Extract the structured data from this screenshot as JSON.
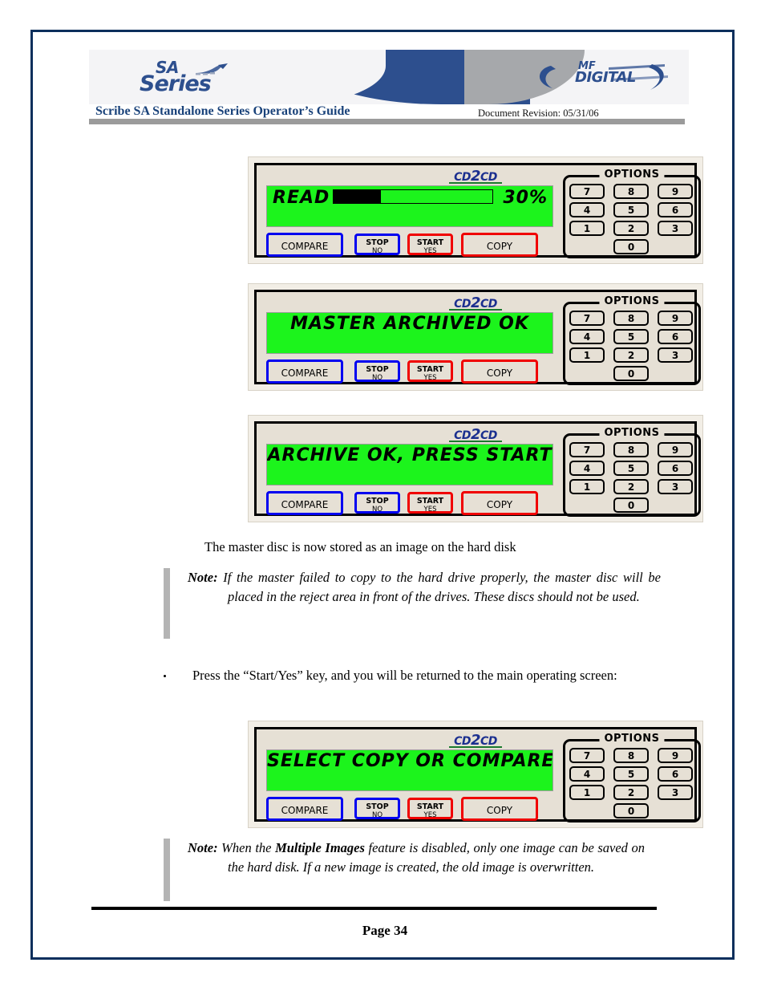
{
  "header": {
    "sa_logo": {
      "line1": "SA",
      "line2": "Series",
      "mark": "swoosh-bird-mark"
    },
    "mf_logo": {
      "line1": "MF",
      "line2": "DIGITAL"
    },
    "doc_title": "Scribe SA Standalone Series Operator’s Guide",
    "doc_revision": "Document Revision: 05/31/06"
  },
  "panels": [
    {
      "id": "panel-read-progress",
      "brand": "CD2CD",
      "lcd_mode": "progress",
      "lcd_label": "READ",
      "lcd_percent_text": "30%",
      "lcd_percent_value": 30,
      "buttons": {
        "compare": "COMPARE",
        "stop_l1": "STOP",
        "stop_l2": "NO",
        "start_l1": "START",
        "start_l2": "YES",
        "copy": "COPY"
      },
      "options_label": "OPTIONS",
      "keys": [
        "7",
        "8",
        "9",
        "4",
        "5",
        "6",
        "1",
        "2",
        "3",
        "0"
      ]
    },
    {
      "id": "panel-master-archived",
      "brand": "CD2CD",
      "lcd_mode": "text",
      "lcd_text": "MASTER ARCHIVED OK",
      "buttons": {
        "compare": "COMPARE",
        "stop_l1": "STOP",
        "stop_l2": "NO",
        "start_l1": "START",
        "start_l2": "YES",
        "copy": "COPY"
      },
      "options_label": "OPTIONS",
      "keys": [
        "7",
        "8",
        "9",
        "4",
        "5",
        "6",
        "1",
        "2",
        "3",
        "0"
      ]
    },
    {
      "id": "panel-archive-ok",
      "brand": "CD2CD",
      "lcd_mode": "text",
      "lcd_text": "ARCHIVE OK, PRESS START",
      "buttons": {
        "compare": "COMPARE",
        "stop_l1": "STOP",
        "stop_l2": "NO",
        "start_l1": "START",
        "start_l2": "YES",
        "copy": "COPY"
      },
      "options_label": "OPTIONS",
      "keys": [
        "7",
        "8",
        "9",
        "4",
        "5",
        "6",
        "1",
        "2",
        "3",
        "0"
      ]
    },
    {
      "id": "panel-select-copy-compare",
      "brand": "CD2CD",
      "lcd_mode": "text",
      "lcd_text": "SELECT COPY OR COMPARE",
      "buttons": {
        "compare": "COMPARE",
        "stop_l1": "STOP",
        "stop_l2": "NO",
        "start_l1": "START",
        "start_l2": "YES",
        "copy": "COPY"
      },
      "options_label": "OPTIONS",
      "keys": [
        "7",
        "8",
        "9",
        "4",
        "5",
        "6",
        "1",
        "2",
        "3",
        "0"
      ]
    }
  ],
  "body": {
    "caption_after_panels": "The master disc is now stored as an image on the hard disk",
    "note1_label": "Note:",
    "note1_text": "If the master failed to copy to the hard drive properly, the master disc will be placed in the reject area in front of the drives. These discs should not be used.",
    "bullet1_text": "Press the “Start/Yes” key, and you will be returned to the main operating screen:",
    "note2_label": "Note:",
    "note2_part1": "When the ",
    "note2_emphasis": "Multiple Images",
    "note2_part2": " feature is disabled, only one image can be saved on the hard disk. If a new image is created, the old image is overwritten."
  },
  "footer": {
    "page_number": "Page 34"
  },
  "colors": {
    "page_border": "#0b2f5c",
    "title_blue": "#19427a",
    "brand_blue": "#2d4f8e",
    "lcd_green": "#1cf41c",
    "panel_beige": "#e6e0d5",
    "button_blue": "#0000f0",
    "button_red": "#f00000",
    "note_bar_gray": "#b4b4b4",
    "header_rule_gray": "#9b9b9b"
  }
}
